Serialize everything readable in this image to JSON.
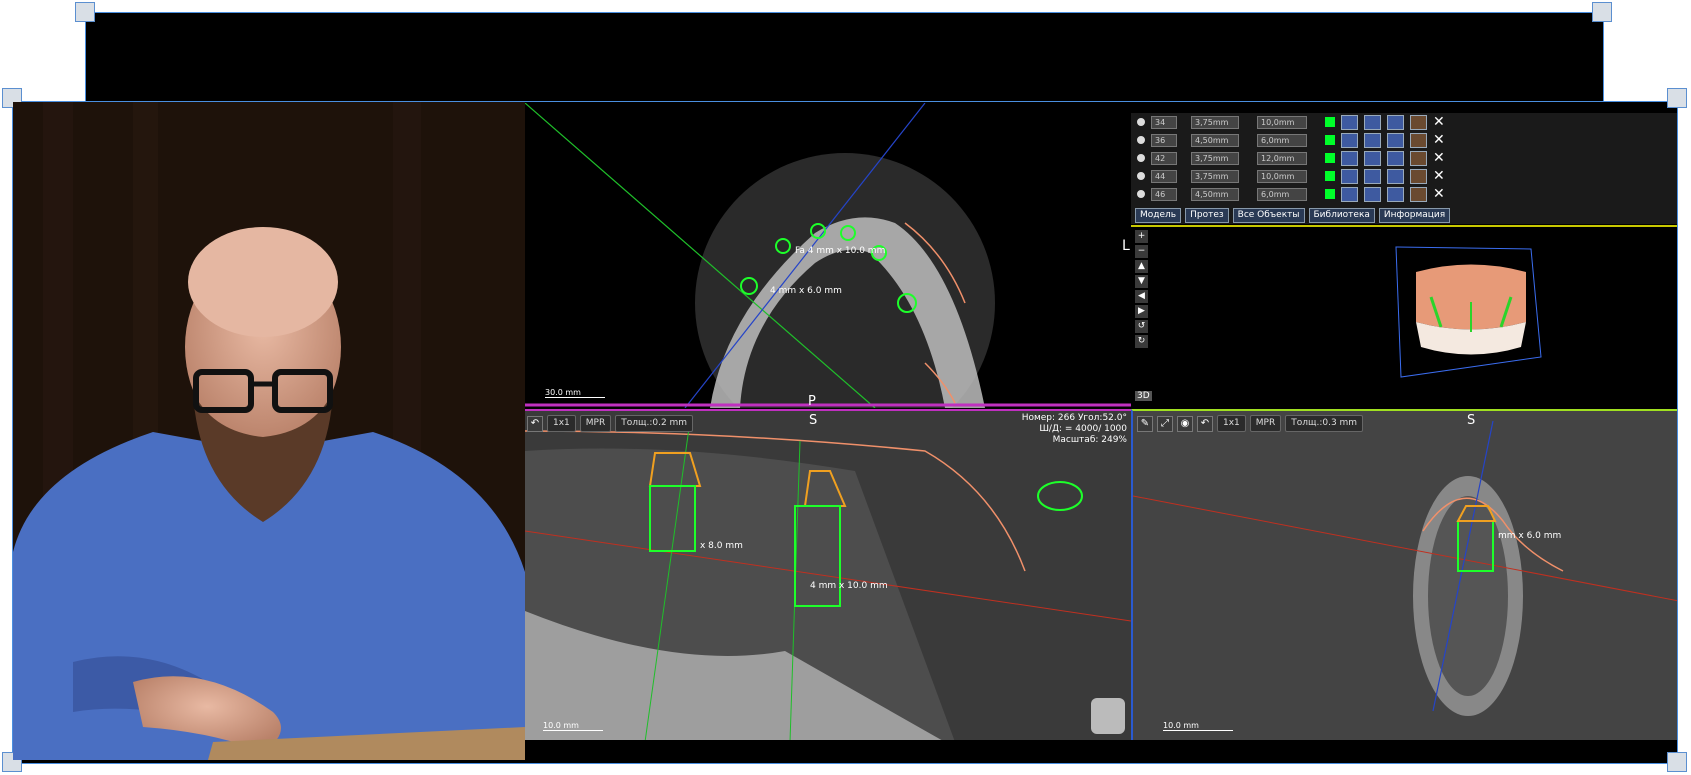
{
  "axial": {
    "orient_left": "L",
    "orient_bottom": "P",
    "scale": "30.0 mm",
    "ann1": "Fa 4 mm x 10.0 mm",
    "ann2": "4 mm x 6.0 mm"
  },
  "sagittal": {
    "orient_top": "S",
    "btn_1x1": "1x1",
    "btn_mpr": "MPR",
    "thickness": "Толщ.:0.2 mm",
    "info_line1": "Номер: 266 Угол:52.0°",
    "info_line2": "Ш/Д: = 4000/ 1000",
    "info_line3": "Масштаб: 249%",
    "ann1": "4 mm x 10.0 mm",
    "ann2": "x 8.0 mm",
    "scale": "10.0 mm"
  },
  "coronal": {
    "orient_top": "S",
    "btn_1x1": "1x1",
    "btn_mpr": "MPR",
    "thickness": "Толщ.:0.3 mm",
    "ann1": "mm x 6.0 mm",
    "scale": "10.0 mm"
  },
  "implants": [
    {
      "num": "34",
      "diam": "3,75mm",
      "len": "10,0mm"
    },
    {
      "num": "36",
      "diam": "4,50mm",
      "len": "6,0mm"
    },
    {
      "num": "42",
      "diam": "3,75mm",
      "len": "12,0mm"
    },
    {
      "num": "44",
      "diam": "3,75mm",
      "len": "10,0mm"
    },
    {
      "num": "46",
      "diam": "4,50mm",
      "len": "6,0mm"
    }
  ],
  "tabs": {
    "model": "Модель",
    "prosthesis": "Протез",
    "all_objects": "Все Объекты",
    "library": "Библиотека",
    "info": "Информация"
  },
  "view3d": {
    "label": "3D"
  }
}
